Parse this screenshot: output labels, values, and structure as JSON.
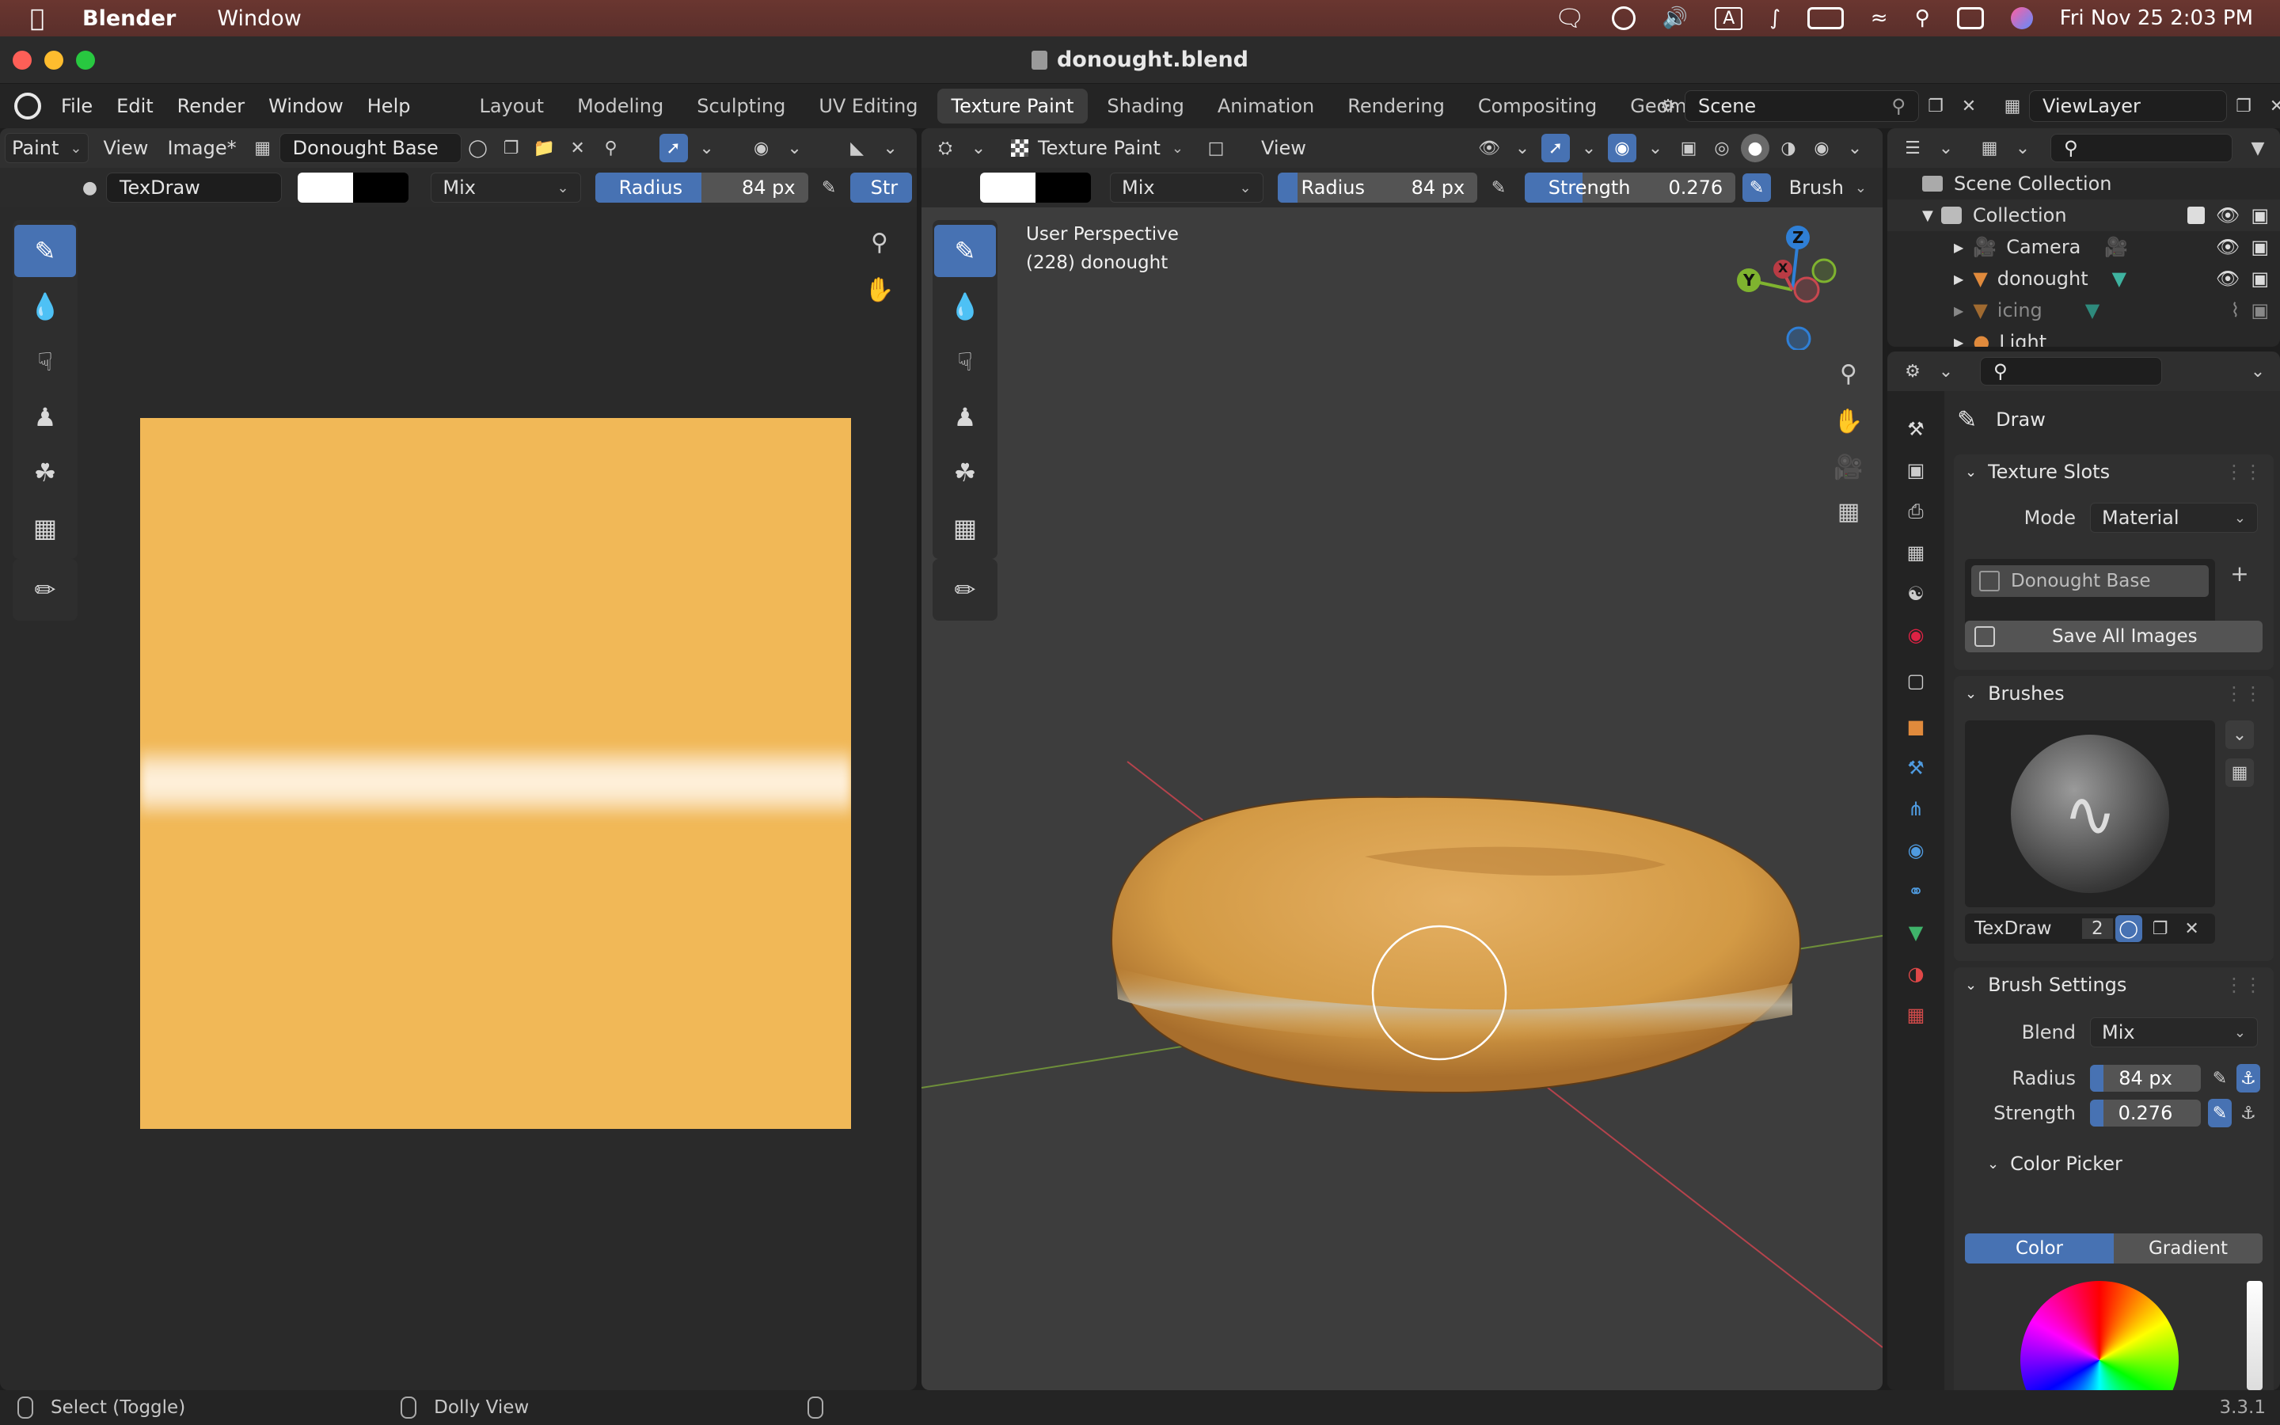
{
  "mac_menubar": {
    "app_name": "Blender",
    "menu_window": "Window",
    "datetime": "Fri Nov 25  2:03 PM",
    "input_source": "A"
  },
  "window": {
    "title": "donought.blend"
  },
  "topbar": {
    "menus": [
      "File",
      "Edit",
      "Render",
      "Window",
      "Help"
    ],
    "workspaces": [
      "Layout",
      "Modeling",
      "Sculpting",
      "UV Editing",
      "Texture Paint",
      "Shading",
      "Animation",
      "Rendering",
      "Compositing",
      "Geometry Nodes"
    ],
    "active_workspace": "Texture Paint",
    "scene": "Scene",
    "view_layer": "ViewLayer"
  },
  "image_editor": {
    "mode": "Paint",
    "view_menu": "View",
    "image_menu": "Image*",
    "image_name": "Donought Base",
    "brush_name": "TexDraw",
    "blend": "Mix",
    "radius_label": "Radius",
    "radius_value": "84 px",
    "radius_fraction": 0.5,
    "strength_label_cut": "Str",
    "canvas_color": "#f1b857"
  },
  "viewport": {
    "mode": "Texture Paint",
    "view_menu": "View",
    "perspective": "User Perspective",
    "object_info": "(228) donought",
    "blend": "Mix",
    "radius_label": "Radius",
    "radius_value": "84 px",
    "strength_label": "Strength",
    "strength_value": "0.276",
    "strength_fraction": 0.276,
    "brush_menu": "Brush",
    "gizmo": {
      "z": "Z",
      "y": "Y",
      "x": "X"
    }
  },
  "outliner": {
    "scene_collection": "Scene Collection",
    "collection": "Collection",
    "items": [
      "Camera",
      "donought",
      "icing",
      "Light"
    ]
  },
  "properties": {
    "brush_title": "Draw",
    "texture_slots": {
      "header": "Texture Slots",
      "mode_label": "Mode",
      "mode_value": "Material",
      "slot": "Donought Base",
      "save_all": "Save All Images"
    },
    "brushes": {
      "header": "Brushes",
      "brush_name": "TexDraw",
      "users": "2"
    },
    "brush_settings": {
      "header": "Brush Settings",
      "blend_label": "Blend",
      "blend_value": "Mix",
      "radius_label": "Radius",
      "radius_value": "84 px",
      "strength_label": "Strength",
      "strength_value": "0.276"
    },
    "color_picker": {
      "header": "Color Picker",
      "tab_color": "Color",
      "tab_gradient": "Gradient"
    }
  },
  "statusbar": {
    "left": "Select (Toggle)",
    "middle": "Dolly View",
    "version": "3.3.1"
  },
  "colors": {
    "accent": "#4772b3",
    "donut": "#d9a24b",
    "axis_x": "#c9474f",
    "axis_y": "#7fb32f",
    "axis_z": "#2f7fd6"
  }
}
